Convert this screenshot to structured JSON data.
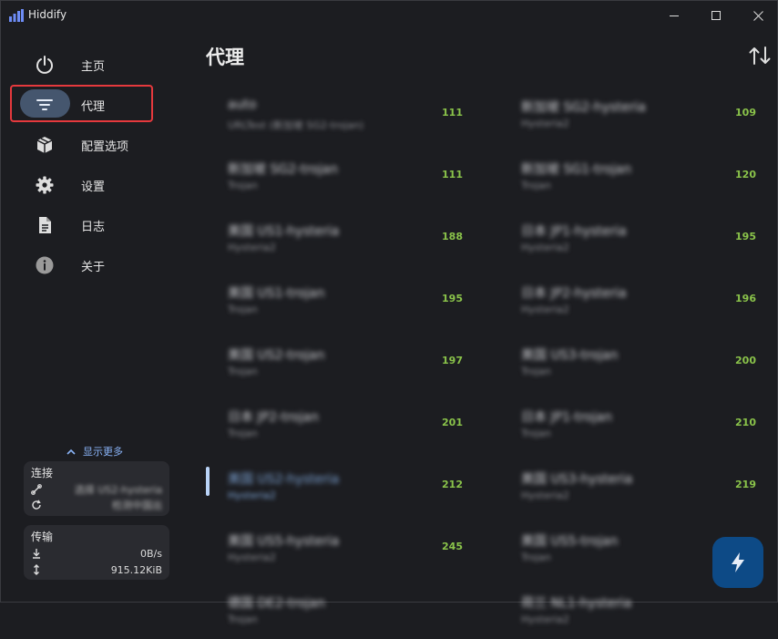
{
  "window": {
    "title": "Hiddify",
    "controls": {
      "minimize": "minimize-icon",
      "maximize": "maximize-icon",
      "close": "close-icon"
    }
  },
  "sidebar": {
    "items": [
      {
        "label": "主页",
        "icon": "power-icon"
      },
      {
        "label": "代理",
        "icon": "filter-icon",
        "active": true
      },
      {
        "label": "配置选项",
        "icon": "box-icon"
      },
      {
        "label": "设置",
        "icon": "gear-icon"
      },
      {
        "label": "日志",
        "icon": "document-icon"
      },
      {
        "label": "关于",
        "icon": "info-icon"
      }
    ],
    "show_more": "显示更多",
    "connection": {
      "title": "连接",
      "proxy": "选择 US2-hysteria",
      "ip": "检测中国出"
    },
    "traffic": {
      "title": "传输",
      "download": "0B/s",
      "total": "915.12KiB"
    }
  },
  "main": {
    "title": "代理",
    "proxies_left": [
      {
        "name": "auto",
        "type": "URLTest (新加坡 SG2-trojan)",
        "delay": "111"
      },
      {
        "name": "新加坡 SG2-trojan",
        "type": "Trojan",
        "delay": "111"
      },
      {
        "name": "美国 US1-hysteria",
        "type": "Hysteria2",
        "delay": "188"
      },
      {
        "name": "美国 US1-trojan",
        "type": "Trojan",
        "delay": "195"
      },
      {
        "name": "美国 US2-trojan",
        "type": "Trojan",
        "delay": "197"
      },
      {
        "name": "日本 JP2-trojan",
        "type": "Trojan",
        "delay": "201"
      },
      {
        "name": "美国 US2-hysteria",
        "type": "Hysteria2",
        "delay": "212"
      },
      {
        "name": "美国 US5-hysteria",
        "type": "Hysteria2",
        "delay": "245"
      },
      {
        "name": "德国 DE2-trojan",
        "type": "Trojan",
        "delay": ""
      }
    ],
    "proxies_right": [
      {
        "name": "新加坡 SG2-hysteria",
        "type": "Hysteria2",
        "delay": "109"
      },
      {
        "name": "新加坡 SG1-trojan",
        "type": "Trojan",
        "delay": "120"
      },
      {
        "name": "日本 JP1-hysteria",
        "type": "Hysteria2",
        "delay": "195"
      },
      {
        "name": "日本 JP2-hysteria",
        "type": "Hysteria2",
        "delay": "196"
      },
      {
        "name": "美国 US3-trojan",
        "type": "Trojan",
        "delay": "200"
      },
      {
        "name": "日本 JP1-trojan",
        "type": "Trojan",
        "delay": "210"
      },
      {
        "name": "美国 US3-hysteria",
        "type": "Hysteria2",
        "delay": "219"
      },
      {
        "name": "美国 US5-trojan",
        "type": "Trojan",
        "delay": ""
      },
      {
        "name": "荷兰 NL1-hysteria",
        "type": "Hysteria2",
        "delay": ""
      }
    ]
  },
  "colors": {
    "accent": "#8ab4f8",
    "delay_good": "#8ac34a",
    "fab": "#0d4a86",
    "highlight": "#e5393d"
  }
}
